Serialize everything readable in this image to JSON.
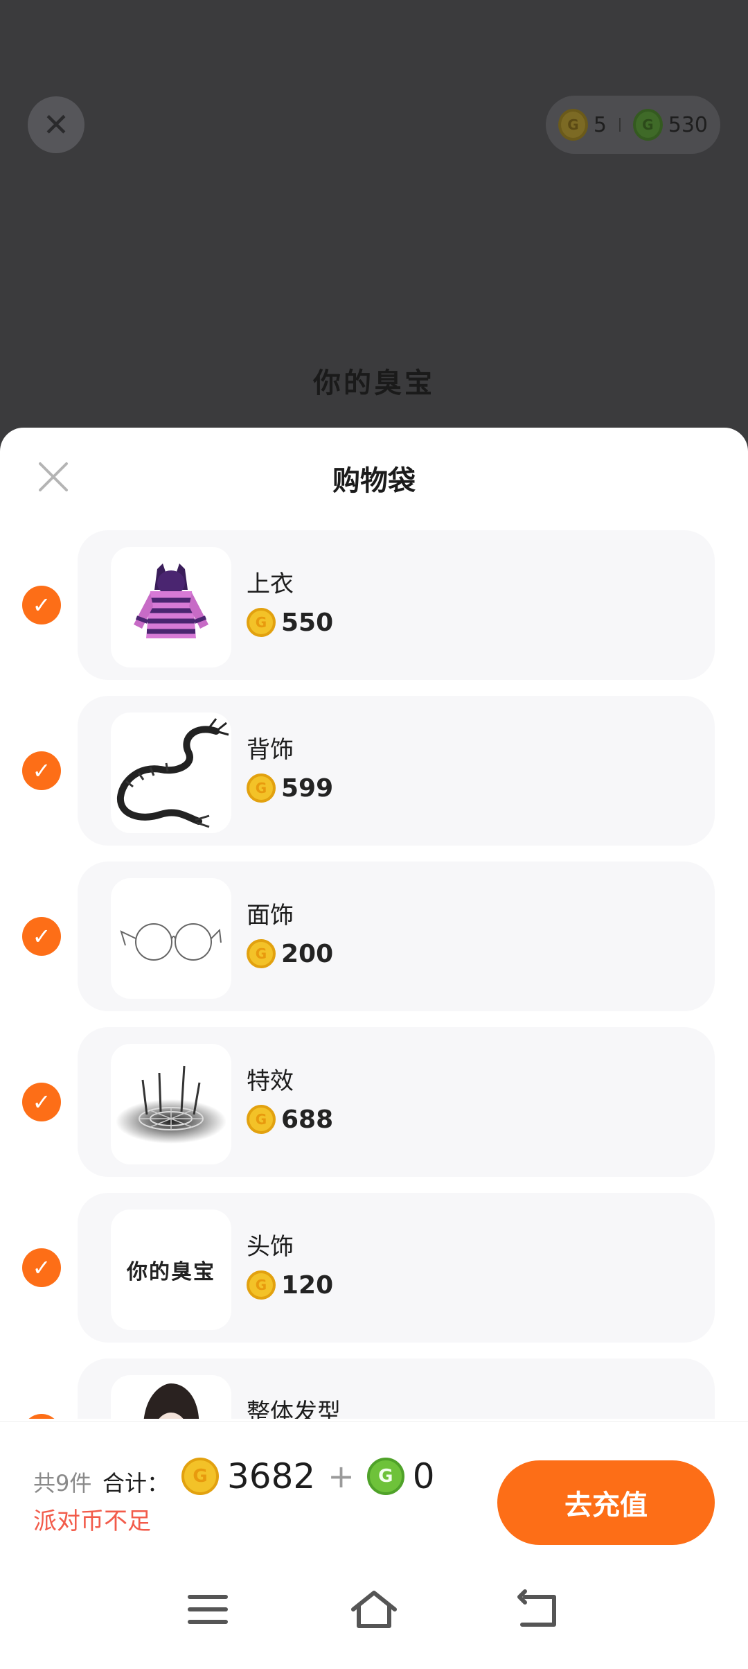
{
  "background": {
    "wallet": {
      "gold_coins": "5",
      "green_coins": "530"
    },
    "preview_text": "你的臭宝"
  },
  "sheet": {
    "title": "购物袋",
    "items": [
      {
        "name": "上衣",
        "price": "550",
        "thumb": "purple-hoodie"
      },
      {
        "name": "背饰",
        "price": "599",
        "thumb": "black-dragon"
      },
      {
        "name": "面饰",
        "price": "200",
        "thumb": "round-glasses"
      },
      {
        "name": "特效",
        "price": "688",
        "thumb": "web-effect"
      },
      {
        "name": "头饰",
        "price": "120",
        "thumb_text": "你的臭宝"
      },
      {
        "name": "整体发型",
        "price": "",
        "thumb": "long-hair"
      }
    ]
  },
  "footer": {
    "count": "共9件",
    "total_label": "合计：",
    "gold_total": "3682",
    "plus": "+",
    "green_total": "0",
    "warning": "派对币不足",
    "button": "去充值"
  },
  "colors": {
    "accent": "#fd6e17",
    "warning": "#f25b4a",
    "gold": "#f3c228",
    "green": "#6ec23a"
  }
}
